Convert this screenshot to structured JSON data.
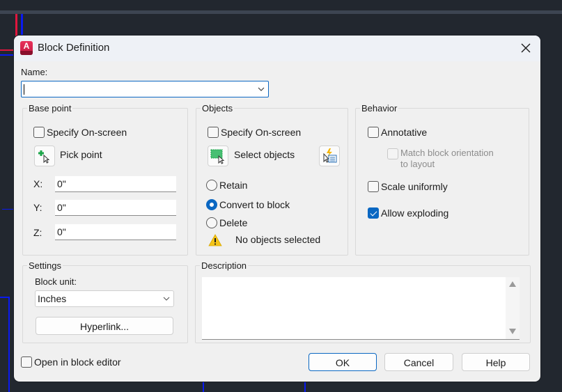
{
  "dialog": {
    "title": "Block Definition",
    "app_icon": "autocad-lt-icon",
    "close_icon": "close-icon"
  },
  "name": {
    "label": "Name:",
    "value": "",
    "dropdown_icon": "chevron-down-icon"
  },
  "base_point": {
    "legend": "Base point",
    "specify_on_screen": {
      "label": "Specify On-screen",
      "checked": false
    },
    "pick_point": {
      "label": "Pick point",
      "icon": "pick-point-icon"
    },
    "x": {
      "label": "X:",
      "value": "0\""
    },
    "y": {
      "label": "Y:",
      "value": "0\""
    },
    "z": {
      "label": "Z:",
      "value": "0\""
    }
  },
  "objects": {
    "legend": "Objects",
    "specify_on_screen": {
      "label": "Specify On-screen",
      "checked": false
    },
    "select_objects": {
      "label": "Select objects",
      "icon": "select-objects-icon"
    },
    "quick_select_icon": "quick-select-icon",
    "radios": [
      {
        "label": "Retain",
        "checked": false
      },
      {
        "label": "Convert to block",
        "checked": true
      },
      {
        "label": "Delete",
        "checked": false
      }
    ],
    "status": {
      "icon": "warning-icon",
      "text": "No objects selected"
    }
  },
  "behavior": {
    "legend": "Behavior",
    "annotative": {
      "label": "Annotative",
      "checked": false
    },
    "match_orientation": {
      "label_line1": "Match block orientation",
      "label_line2": "to layout",
      "checked": false,
      "disabled": true
    },
    "scale_uniformly": {
      "label": "Scale uniformly",
      "checked": false
    },
    "allow_exploding": {
      "label": "Allow exploding",
      "checked": true
    }
  },
  "settings": {
    "legend": "Settings",
    "block_unit_label": "Block unit:",
    "block_unit_value": "Inches",
    "hyperlink_label": "Hyperlink..."
  },
  "description": {
    "legend": "Description",
    "value": ""
  },
  "footer": {
    "open_in_editor": {
      "label": "Open in block editor",
      "checked": false
    },
    "ok_label": "OK",
    "cancel_label": "Cancel",
    "help_label": "Help"
  },
  "colors": {
    "accent": "#0a67c2",
    "background_canvas": "#22272f",
    "dialog_bg": "#f0f0f0"
  }
}
